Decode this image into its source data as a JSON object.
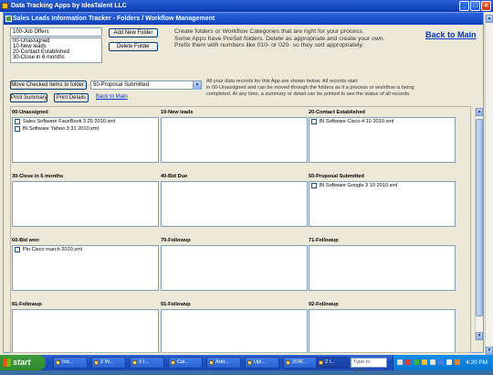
{
  "outer_window": {
    "title": "Data Tracking Apps by IdeaTalent LLC",
    "controls": {
      "minimize": "_",
      "maximize": "□",
      "close": "×"
    }
  },
  "inner_window": {
    "title": "Sales Leads Information Tracker - Folders / Workflow Management"
  },
  "folder_listbox": {
    "items": [
      "100-Job Offers",
      "00-Unassigned",
      "10-New leads",
      "20-Contact Established",
      "30-Close in 6 months"
    ]
  },
  "buttons": {
    "add_new_folder": "Add New Folder",
    "delete_folder": "Delete Folder",
    "move_checked": "Move Checked Items to folder:",
    "print_summary": "Print Summary",
    "print_details": "Print Details"
  },
  "instructions": {
    "lines": [
      "Create folders or Workflow Categories that are right for your process.",
      "Some Apps have PreSet folders. Delete as appropriate and create your own.",
      "Prefix them with numbers like 010- or 020- so they sort appropriately."
    ]
  },
  "links": {
    "back_to_main_large": "Back to Main",
    "back_to_main_small": "Back to Main"
  },
  "move_target": {
    "selected": "50-Proposal Submitted",
    "arrow": "▼"
  },
  "info_text": {
    "lines": [
      "All your data records for this App are shown below. All records start",
      "in 00-Unassigned and can be moved through the folders as if a process or workflow is being",
      "completed. At any time, a summary or detail can be printed to see the status of all records."
    ]
  },
  "folders": [
    {
      "label": "00-Unassigned",
      "items": [
        "Sales Software FaceBook 3 25 2010.xml",
        "BI Software Yahoo 3 31 2010.xml"
      ]
    },
    {
      "label": "10-New leads",
      "items": []
    },
    {
      "label": "20-Contact Established",
      "items": [
        "BI Software Cisco 4 10 2010.xml"
      ]
    },
    {
      "label": "30-Close in 6 months",
      "items": []
    },
    {
      "label": "40-Bid Due",
      "items": []
    },
    {
      "label": "50-Proposal Submitted",
      "items": [
        "BI Software Google 3 10 2010.xml"
      ]
    },
    {
      "label": "60-Bid won",
      "items": [
        "Pin Cisco march 2010.xml"
      ]
    },
    {
      "label": "70-Followup",
      "items": []
    },
    {
      "label": "71-Followup",
      "items": []
    },
    {
      "label": "81-Followup",
      "items": []
    },
    {
      "label": "91-Followup",
      "items": []
    },
    {
      "label": "92-Followup",
      "items": []
    }
  ],
  "scrollbar": {
    "up": "▲",
    "down": "▼"
  },
  "taskbar": {
    "start": "start",
    "items": [
      {
        "label": "Inb..."
      },
      {
        "label": "2 W..."
      },
      {
        "label": "3 I..."
      },
      {
        "label": "Cal..."
      },
      {
        "label": "Add..."
      },
      {
        "label": "Upl..."
      },
      {
        "label": "2OR..."
      },
      {
        "label": "2 I..."
      }
    ],
    "search_placeholder": "Type to search",
    "clock": "4:20 PM"
  },
  "colors": {
    "title_bar": "#0a3cb0",
    "link": "#0033cc",
    "taskbar": "#245edb",
    "start_button": "#3c9a3c"
  }
}
